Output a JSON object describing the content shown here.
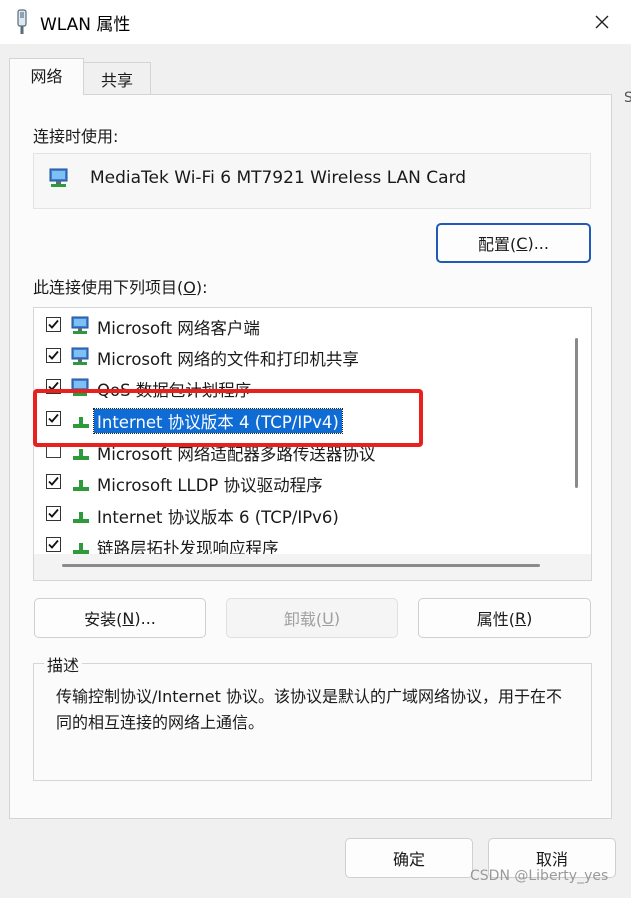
{
  "window": {
    "title": "WLAN 属性",
    "close_label": "✕"
  },
  "tabs": [
    {
      "label": "网络",
      "active": true
    },
    {
      "label": "共享",
      "active": false
    }
  ],
  "connect_using": {
    "label": "连接时使用:",
    "adapter": "MediaTek Wi-Fi 6 MT7921 Wireless LAN Card"
  },
  "configure_button": {
    "label_prefix": "配置(",
    "mnemonic": "C",
    "label_suffix": ")..."
  },
  "items_section": {
    "label_prefix": "此连接使用下列项目(",
    "mnemonic": "O",
    "label_suffix": "):"
  },
  "items": [
    {
      "label": "Microsoft 网络客户端",
      "checked": true,
      "icon": "network-client-icon"
    },
    {
      "label": "Microsoft 网络的文件和打印机共享",
      "checked": true,
      "icon": "file-sharing-icon"
    },
    {
      "label": "QoS 数据包计划程序",
      "checked": true,
      "icon": "qos-icon"
    },
    {
      "label": "Internet 协议版本 4 (TCP/IPv4)",
      "checked": true,
      "icon": "protocol-icon",
      "selected": true
    },
    {
      "label": "Microsoft 网络适配器多路传送器协议",
      "checked": false,
      "icon": "protocol-icon"
    },
    {
      "label": "Microsoft LLDP 协议驱动程序",
      "checked": true,
      "icon": "protocol-icon"
    },
    {
      "label": "Internet 协议版本 6 (TCP/IPv6)",
      "checked": true,
      "icon": "protocol-icon"
    },
    {
      "label": "链路层拓扑发现响应程序",
      "checked": true,
      "icon": "protocol-icon"
    }
  ],
  "action_buttons": {
    "install": {
      "label_prefix": "安装(",
      "mnemonic": "N",
      "label_suffix": ")..."
    },
    "uninstall": {
      "label_prefix": "卸载(",
      "mnemonic": "U",
      "label_suffix": ")"
    },
    "properties": {
      "label_prefix": "属性(",
      "mnemonic": "R",
      "label_suffix": ")"
    }
  },
  "description": {
    "legend": "描述",
    "text": "传输控制协议/Internet 协议。该协议是默认的广域网络协议，用于在不同的相互连接的网络上通信。"
  },
  "footer": {
    "ok_label": "确定",
    "cancel_label": "取消"
  },
  "watermark": "CSDN @Liberty_yes",
  "edge_text": "S",
  "colors": {
    "highlight_red": "#e8201e",
    "selection_blue": "#0e6cd4",
    "primary_border": "#1e5bb8"
  }
}
